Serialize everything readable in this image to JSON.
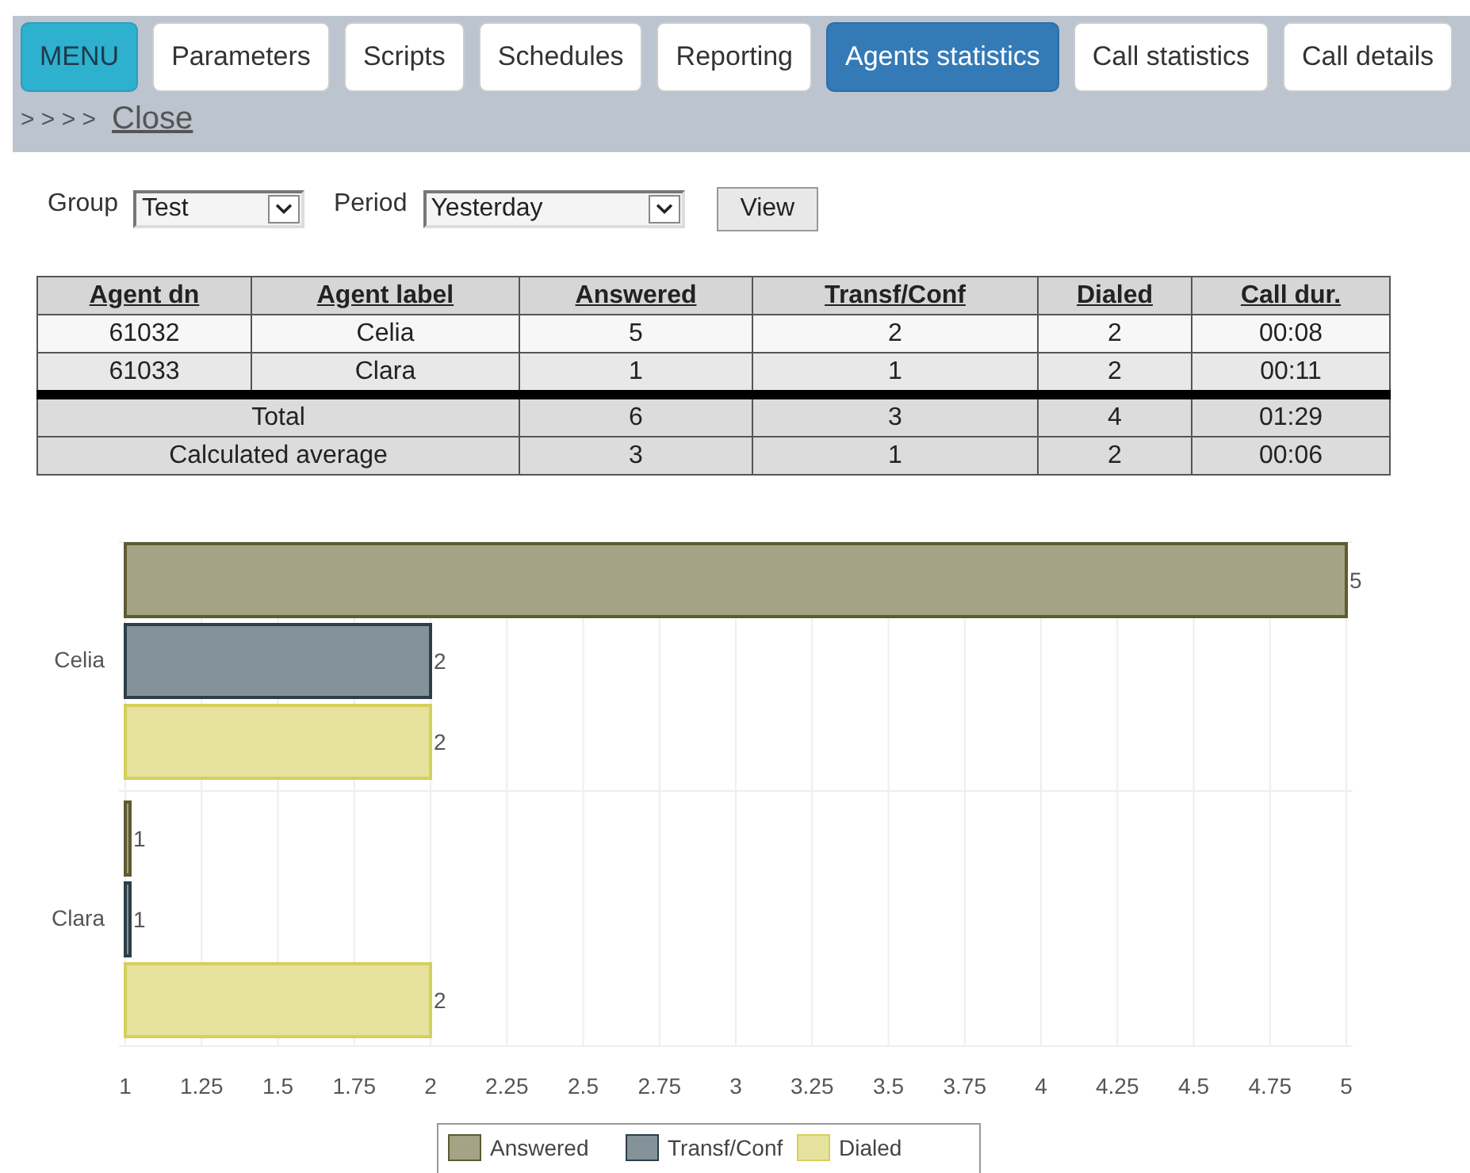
{
  "menu_button": "MENU",
  "tabs": [
    {
      "label": "Parameters",
      "selected": false
    },
    {
      "label": "Scripts",
      "selected": false
    },
    {
      "label": "Schedules",
      "selected": false
    },
    {
      "label": "Reporting",
      "selected": false
    },
    {
      "label": "Agents statistics",
      "selected": true
    },
    {
      "label": "Call statistics",
      "selected": false
    },
    {
      "label": "Call details",
      "selected": false
    }
  ],
  "breadcrumb": {
    "arrows": "> > > >",
    "link": "Close"
  },
  "filters": {
    "group": {
      "label": "Group",
      "value": "Test"
    },
    "period": {
      "label": "Period",
      "value": "Yesterday"
    },
    "button": "View"
  },
  "table": {
    "columns": [
      "Agent dn",
      "Agent label",
      "Answered",
      "Transf/Conf",
      "Dialed",
      "Call dur."
    ],
    "rows": [
      [
        "61032",
        "Celia",
        "5",
        "2",
        "2",
        "00:08"
      ],
      [
        "61033",
        "Clara",
        "1",
        "1",
        "2",
        "00:11"
      ]
    ],
    "summary": [
      [
        "Total",
        "6",
        "3",
        "4",
        "01:29"
      ],
      [
        "Calculated average",
        "3",
        "1",
        "2",
        "00:06"
      ]
    ]
  },
  "chart": {
    "chart_data": {
      "type": "bar",
      "orientation": "horizontal",
      "categories": [
        "Celia",
        "Clara"
      ],
      "series": [
        {
          "name": "Answered",
          "color": "#a5a386",
          "values": [
            5,
            1
          ]
        },
        {
          "name": "Transf/Conf",
          "color": "#84939a",
          "values": [
            2,
            1
          ]
        },
        {
          "name": "Dialed",
          "color": "#e6e29d",
          "values": [
            2,
            2
          ]
        }
      ],
      "xlim": [
        1,
        5
      ],
      "xticks": [
        {
          "value": 1,
          "label": "1"
        },
        {
          "value": 1.25,
          "label": "1.25"
        },
        {
          "value": 1.5,
          "label": "1.5"
        },
        {
          "value": 1.75,
          "label": "1.75"
        },
        {
          "value": 2,
          "label": "2"
        },
        {
          "value": 2.25,
          "label": "2.25"
        },
        {
          "value": 2.5,
          "label": "2.5"
        },
        {
          "value": 2.75,
          "label": "2.75"
        },
        {
          "value": 3,
          "label": "3"
        },
        {
          "value": 3.25,
          "label": "3.25"
        },
        {
          "value": 3.5,
          "label": "3.5"
        },
        {
          "value": 3.75,
          "label": "3.75"
        },
        {
          "value": 4,
          "label": "4"
        },
        {
          "value": 4.25,
          "label": "4.25"
        },
        {
          "value": 4.5,
          "label": "4.5"
        },
        {
          "value": 4.75,
          "label": "4.75"
        },
        {
          "value": 5,
          "label": "5"
        }
      ],
      "data_labels": true,
      "grid": true,
      "legend": true
    }
  }
}
